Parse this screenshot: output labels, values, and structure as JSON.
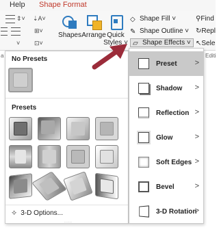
{
  "ribbon": {
    "tabs": [
      {
        "label": "Help",
        "active": false
      },
      {
        "label": "Shape Format",
        "active": true
      }
    ],
    "big_buttons": [
      {
        "label": "Shapes",
        "icon": "shapes-icon"
      },
      {
        "label": "Arrange",
        "icon": "arrange-icon"
      },
      {
        "label": "Quick",
        "sublabel": "Styles ˅",
        "icon": "quick-styles-icon"
      }
    ],
    "shape_fill": "Shape Fill ˅",
    "shape_outline": "Shape Outline ˅",
    "shape_effects": "Shape Effects ˅",
    "right_commands": [
      "Find",
      "Repl",
      "Sele"
    ],
    "group_label_left": "a",
    "group_label_right": "Editi"
  },
  "gallery": {
    "no_presets_heading": "No Presets",
    "presets_heading": "Presets",
    "preset_count": 12,
    "options_label": "3-D Options...",
    "grip": "....",
    "options_icon": "3d-options-icon"
  },
  "menu": {
    "items": [
      {
        "label": "Preset",
        "active": true,
        "icon": "preset-icon",
        "arrow": ">"
      },
      {
        "label": "Shadow",
        "active": false,
        "icon": "shadow-icon",
        "arrow": ">"
      },
      {
        "label": "Reflection",
        "active": false,
        "icon": "reflection-icon",
        "arrow": ">"
      },
      {
        "label": "Glow",
        "active": false,
        "icon": "glow-icon",
        "arrow": ">"
      },
      {
        "label": "Soft Edges",
        "active": false,
        "icon": "soft-edges-icon",
        "arrow": ">"
      },
      {
        "label": "Bevel",
        "active": false,
        "icon": "bevel-icon",
        "arrow": ">"
      },
      {
        "label": "3-D Rotation",
        "active": false,
        "icon": "3d-rotation-icon",
        "arrow": ">"
      }
    ]
  },
  "colors": {
    "accent_tab": "#c0392b",
    "arrow": "#9b2c3a",
    "menu_highlight": "#c9c9c9",
    "ribbon_bg": "#f7f7f7"
  }
}
